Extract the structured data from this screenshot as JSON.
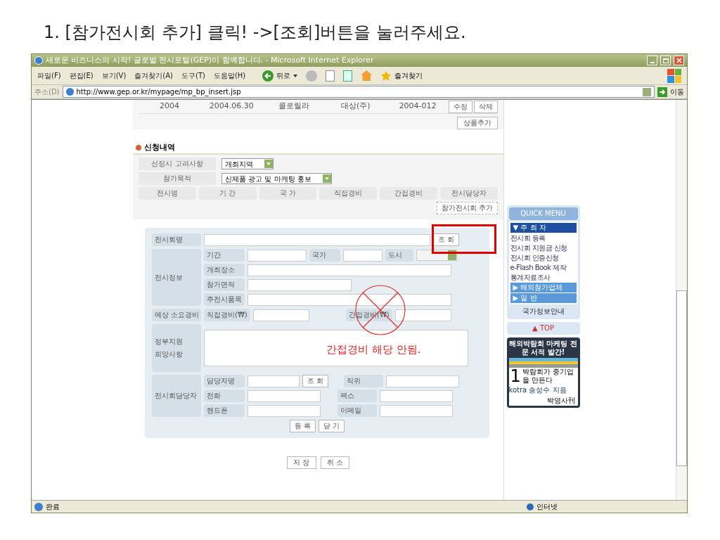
{
  "slide_title": "1. [참가전시회 추가] 클릭! ->[조회]버튼을 눌러주세요.",
  "window": {
    "title": "새로운 비즈니스의 시작! 글로벌 전시포털(GEP)이 함께합니다. - Microsoft Internet Explorer",
    "menu": [
      "파일(F)",
      "편집(E)",
      "보기(V)",
      "즐겨찾기(A)",
      "도구(T)",
      "도움말(H)"
    ],
    "toolbar": {
      "back": "뒤로",
      "favorites": "즐겨찾기"
    },
    "address": {
      "label": "주소(D)",
      "url": "http://www.gep.or.kr/mypage/mp_bp_insert.jsp",
      "go": "이동"
    }
  },
  "product_row": {
    "cells": [
      "2004",
      "2004.06.30",
      "콜로릴라",
      "대상(주)",
      "2004-012"
    ],
    "buttons": [
      "수정",
      "삭제"
    ]
  },
  "add_product_button": "상품추가",
  "section_title": "신청내역",
  "selects": [
    {
      "label": "선정시 고려사항",
      "value": "개최지역"
    },
    {
      "label": "참가목적",
      "value": "신제품 광고 및 마케팅 홍보"
    }
  ],
  "columns": [
    "전시명",
    "기 간",
    "국 가",
    "직접경비",
    "간접경비",
    "전시담당자"
  ],
  "add_exhibition_button": "참가전시회 추가",
  "form": {
    "name_label": "전시회명",
    "lookup_button": "조 회",
    "info_label": "전시정보",
    "period": "기간",
    "country": "국가",
    "city": "도시",
    "venue": "개최장소",
    "area": "참가면적",
    "items": "주전시품목",
    "cost_label": "예상 소요경비",
    "direct": "직접경비(₩)",
    "indirect": "간접경비(₩)",
    "support_label": "정부지원 희망사항",
    "contact_label": "전시회담당자",
    "manager": "담당자명",
    "manager_lookup": "조 회",
    "position": "직위",
    "phone": "전화",
    "fax": "팩스",
    "mobile": "핸드폰",
    "email": "이메일",
    "buttons": [
      "등 록",
      "닫 기"
    ]
  },
  "bottom_buttons": [
    "저 장",
    "취 소"
  ],
  "quick_menu": {
    "title": "QUICK MENU",
    "host": "▼ 주 최 자",
    "links": [
      "전시회 등록",
      "전시회 지원금 신청",
      "전시회 인증신청",
      "e-Flash Book 제작",
      "통계자료조사"
    ],
    "sections": [
      "▶ 해외참가업체",
      "▶ 일 반"
    ],
    "country_info": "국가정보안내",
    "top": "▲ TOP"
  },
  "ad": {
    "headline": "해외박람회 마케팅 전문 서적 발간!",
    "number": "1",
    "book_title": "박람회가 중기업을 만든다",
    "author": "kotra 송성수 지음",
    "publisher": "박영사刊"
  },
  "status_bar": {
    "status": "완료",
    "zone": "인터넷"
  },
  "annotation": {
    "text": "간접경비 해당 안됨."
  }
}
